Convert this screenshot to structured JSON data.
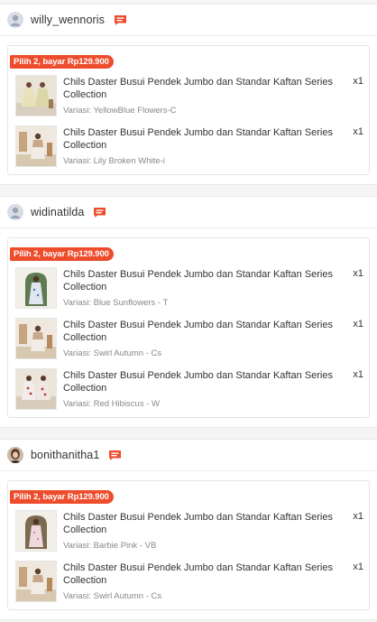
{
  "orders": [
    {
      "buyer": "willy_wennoris",
      "avatar": "default-avatar-icon",
      "promo": "Pilih 2, bayar Rp129.900",
      "items": [
        {
          "title": "Chils Daster Busui Pendek Jumbo dan Standar Kaftan Series Collection",
          "variation": "Variasi: YellowBlue Flowers-C",
          "qty": "x1",
          "thumb": "two-models"
        },
        {
          "title": "Chils Daster Busui Pendek Jumbo dan Standar Kaftan Series Collection",
          "variation": "Variasi: Lily Broken White-i",
          "qty": "x1",
          "thumb": "single-model-room"
        }
      ]
    },
    {
      "buyer": "widinatilda",
      "avatar": "default-avatar-icon",
      "promo": "Pilih 2, bayar Rp129.900",
      "items": [
        {
          "title": "Chils Daster Busui Pendek Jumbo dan Standar Kaftan Series Collection",
          "variation": "Variasi: Blue Sunflowers - T",
          "qty": "x1",
          "thumb": "arch-model"
        },
        {
          "title": "Chils Daster Busui Pendek Jumbo dan Standar Kaftan Series Collection",
          "variation": "Variasi: Swirl Autumn - Cs",
          "qty": "x1",
          "thumb": "single-model-room"
        },
        {
          "title": "Chils Daster Busui Pendek Jumbo dan Standar Kaftan Series Collection",
          "variation": "Variasi: Red Hibiscus - W",
          "qty": "x1",
          "thumb": "two-models-red"
        }
      ]
    },
    {
      "buyer": "bonithanitha1",
      "avatar": "photo-avatar",
      "promo": "Pilih 2, bayar Rp129.900",
      "items": [
        {
          "title": "Chils Daster Busui Pendek Jumbo dan Standar Kaftan Series Collection",
          "variation": "Variasi: Barbie Pink - VB",
          "qty": "x1",
          "thumb": "arch-model-pink"
        },
        {
          "title": "Chils Daster Busui Pendek Jumbo dan Standar Kaftan Series Collection",
          "variation": "Variasi: Swirl Autumn - Cs",
          "qty": "x1",
          "thumb": "single-model-room"
        }
      ]
    }
  ],
  "colors": {
    "accent": "#ee4d2d",
    "chat_icon": "#ee4d2d"
  },
  "icons": {
    "chat": "chat-bubble-icon"
  }
}
